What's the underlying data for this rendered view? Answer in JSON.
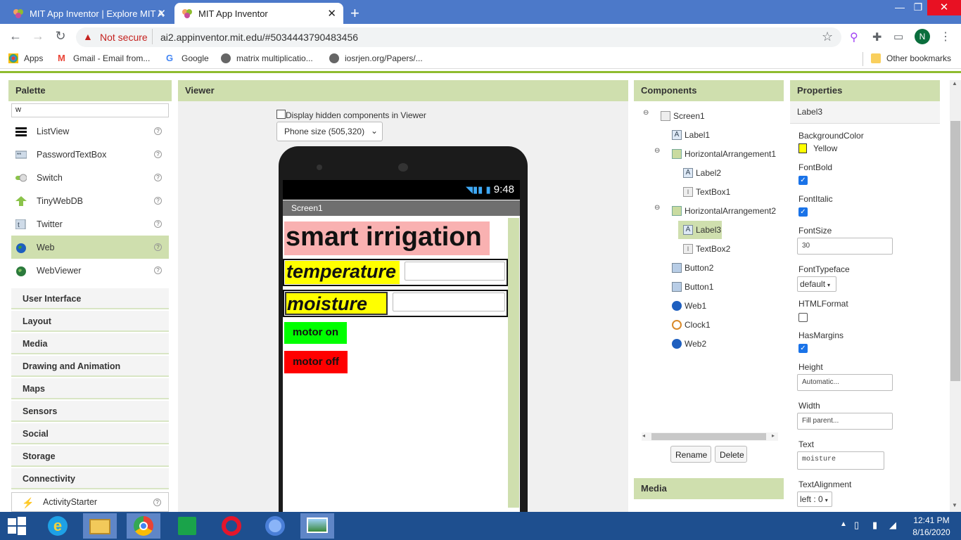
{
  "browser": {
    "tabs": [
      {
        "title": "MIT App Inventor | Explore MIT A"
      },
      {
        "title": "MIT App Inventor"
      }
    ],
    "security_label": "Not secure",
    "url": "ai2.appinventor.mit.edu/#5034443790483456",
    "profile_initial": "N",
    "bookmarks": [
      {
        "label": "Apps"
      },
      {
        "label": "Gmail - Email from..."
      },
      {
        "label": "Google"
      },
      {
        "label": "matrix multiplicatio..."
      },
      {
        "label": "iosrjen.org/Papers/..."
      }
    ],
    "other_bookmarks": "Other bookmarks"
  },
  "palette": {
    "title": "Palette",
    "search_value": "w",
    "items": [
      {
        "label": "ListView",
        "icon": "list-icon"
      },
      {
        "label": "PasswordTextBox",
        "icon": "password-icon"
      },
      {
        "label": "Switch",
        "icon": "switch-icon"
      },
      {
        "label": "TinyWebDB",
        "icon": "arrow-up-icon"
      },
      {
        "label": "Twitter",
        "icon": "twitter-icon"
      },
      {
        "label": "Web",
        "icon": "globe-icon"
      },
      {
        "label": "WebViewer",
        "icon": "globe-icon"
      }
    ],
    "help_glyph": "?",
    "categories": [
      "User Interface",
      "Layout",
      "Media",
      "Drawing and Animation",
      "Maps",
      "Sensors",
      "Social",
      "Storage",
      "Connectivity"
    ],
    "connectivity_first": "ActivityStarter"
  },
  "viewer": {
    "title": "Viewer",
    "hidden_label": "Display hidden components in Viewer",
    "size_option": "Phone size (505,320)",
    "status_time": "9:48",
    "screen_title": "Screen1",
    "app_title": "smart irrigation",
    "label2": "temperature",
    "label3": "moisture",
    "button2": "motor on",
    "button1": "motor off"
  },
  "components": {
    "title": "Components",
    "tree": [
      {
        "label": "Screen1"
      },
      {
        "label": "Label1"
      },
      {
        "label": "HorizontalArrangement1"
      },
      {
        "label": "Label2"
      },
      {
        "label": "TextBox1"
      },
      {
        "label": "HorizontalArrangement2"
      },
      {
        "label": "Label3"
      },
      {
        "label": "TextBox2"
      },
      {
        "label": "Button2"
      },
      {
        "label": "Button1"
      },
      {
        "label": "Web1"
      },
      {
        "label": "Clock1"
      },
      {
        "label": "Web2"
      }
    ],
    "rename": "Rename",
    "delete": "Delete",
    "media_title": "Media"
  },
  "properties": {
    "title": "Properties",
    "selected": "Label3",
    "background_color_label": "BackgroundColor",
    "background_color_value": "Yellow",
    "font_bold": "FontBold",
    "font_italic": "FontItalic",
    "font_size": "FontSize",
    "font_size_value": "30",
    "font_typeface": "FontTypeface",
    "font_typeface_value": "default",
    "html_format": "HTMLFormat",
    "has_margins": "HasMargins",
    "height": "Height",
    "height_value": "Automatic...",
    "width": "Width",
    "width_value": "Fill parent...",
    "text": "Text",
    "text_value": "moisture",
    "text_alignment": "TextAlignment",
    "text_alignment_value": "left : 0"
  },
  "taskbar": {
    "time": "12:41 PM",
    "date": "8/16/2020"
  },
  "colors": {
    "panel_header": "#cfdfae",
    "accent_pink": "#f9b1b1",
    "accent_yellow": "#ffff00",
    "motor_on": "#00ff00",
    "motor_off": "#ff0000"
  }
}
